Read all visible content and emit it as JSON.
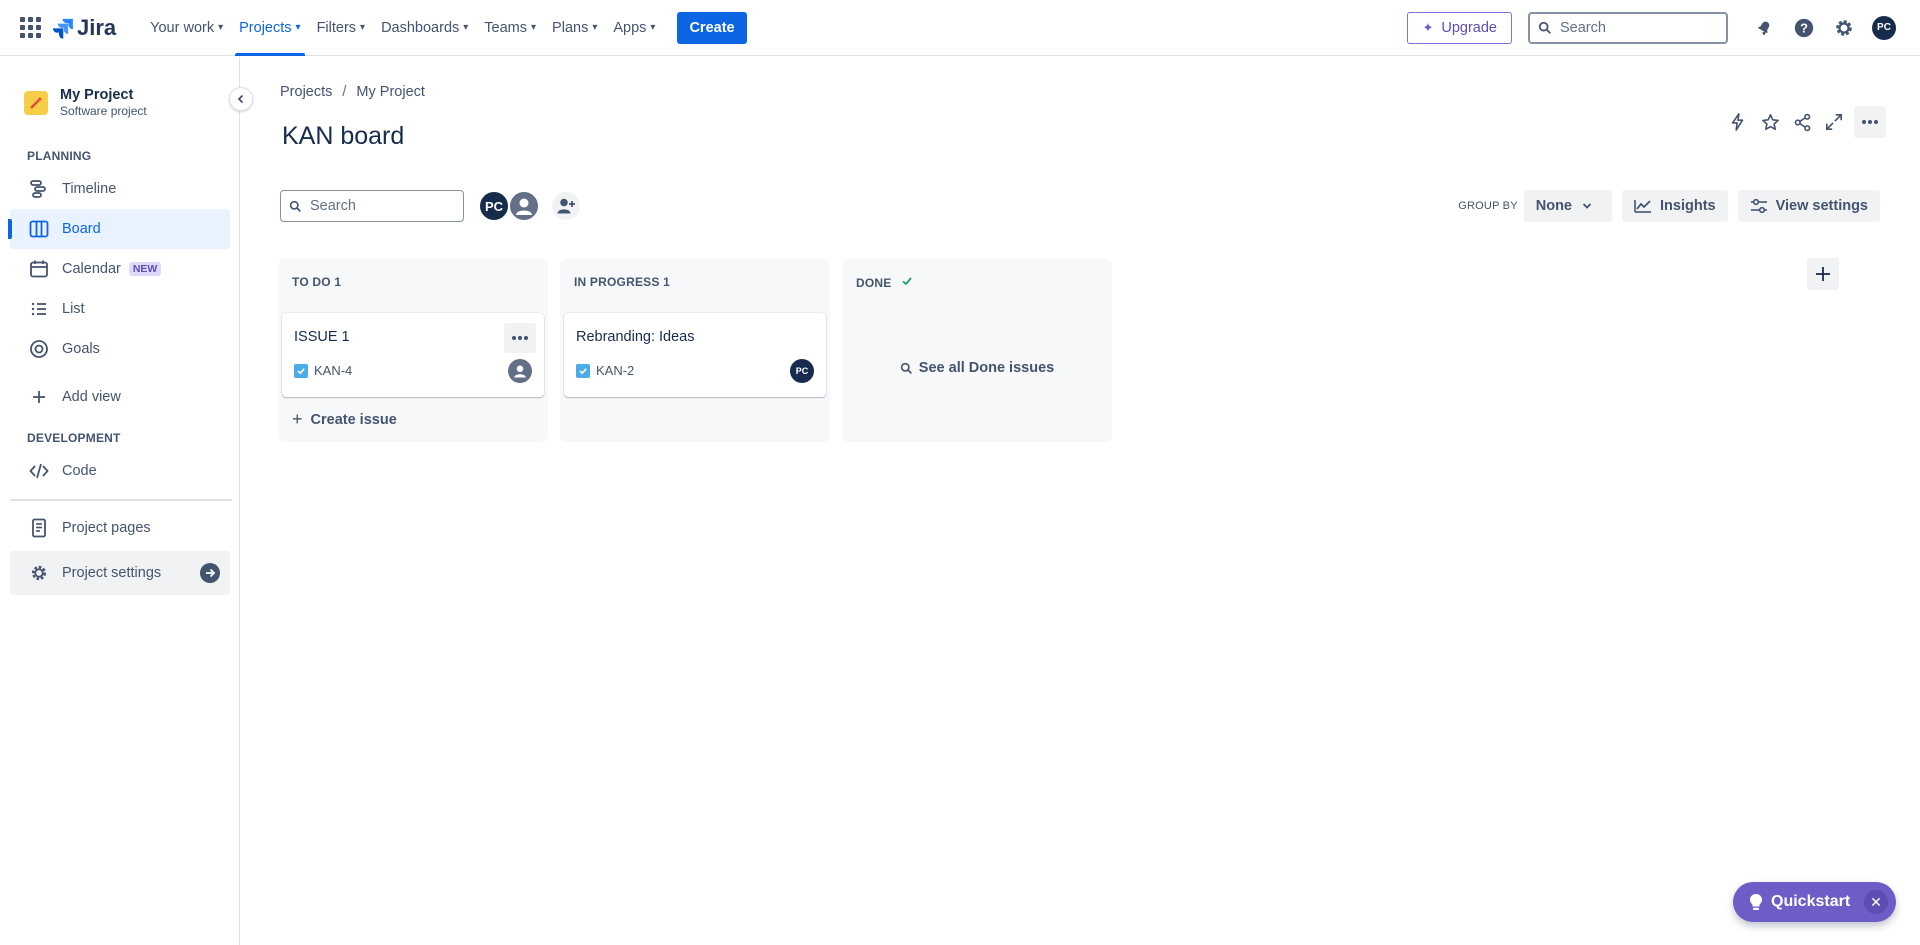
{
  "topnav": {
    "logo_text": "Jira",
    "items": [
      {
        "label": "Your work"
      },
      {
        "label": "Projects"
      },
      {
        "label": "Filters"
      },
      {
        "label": "Dashboards"
      },
      {
        "label": "Teams"
      },
      {
        "label": "Plans"
      },
      {
        "label": "Apps"
      }
    ],
    "active_item": "Projects",
    "create_label": "Create",
    "upgrade_label": "Upgrade",
    "search_placeholder": "Search",
    "user_initials": "PC",
    "accent_color": "#0c66e4"
  },
  "sidebar": {
    "project_name": "My Project",
    "project_type": "Software project",
    "planning_label": "PLANNING",
    "development_label": "DEVELOPMENT",
    "items": [
      {
        "label": "Timeline",
        "icon": "timeline-icon"
      },
      {
        "label": "Board",
        "icon": "board-icon",
        "selected": true
      },
      {
        "label": "Calendar",
        "icon": "calendar-icon",
        "badge": "NEW"
      },
      {
        "label": "List",
        "icon": "list-icon"
      },
      {
        "label": "Goals",
        "icon": "goals-icon"
      },
      {
        "label": "Add view",
        "icon": "plus-icon"
      },
      {
        "label": "Code",
        "icon": "code-icon"
      },
      {
        "label": "Project pages",
        "icon": "page-icon"
      },
      {
        "label": "Project settings",
        "icon": "gear-icon"
      }
    ]
  },
  "breadcrumb": {
    "items": [
      "Projects",
      "My Project"
    ],
    "separator": "/"
  },
  "page": {
    "title": "KAN board"
  },
  "board": {
    "search_placeholder": "Search",
    "avatar_initials": "PC",
    "group_by_label": "GROUP BY",
    "group_by_value": "None",
    "insights_label": "Insights",
    "view_settings_label": "View settings",
    "columns": [
      {
        "title": "TO DO 1",
        "cards": [
          {
            "title": "ISSUE 1",
            "key": "KAN-4",
            "assignee": "unassigned"
          }
        ],
        "create_label": "Create issue"
      },
      {
        "title": "IN PROGRESS 1",
        "cards": [
          {
            "title": "Rebranding: Ideas",
            "key": "KAN-2",
            "assignee": "PC"
          }
        ]
      },
      {
        "title": "DONE",
        "done_check": true,
        "see_all_label": "See all Done issues"
      }
    ]
  },
  "quickstart": {
    "label": "Quickstart",
    "color": "#6e5dc6"
  }
}
